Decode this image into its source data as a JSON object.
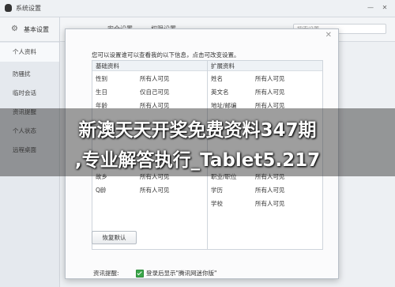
{
  "window": {
    "title": "系统设置",
    "minimize": "—",
    "close": "✕"
  },
  "sidebar": {
    "header": "基本设置",
    "items": [
      {
        "label": "个人资料"
      },
      {
        "label": "防骚扰"
      },
      {
        "label": "临时会话"
      },
      {
        "label": "资讯提醒"
      },
      {
        "label": "个人状态"
      },
      {
        "label": "远程桌面"
      }
    ]
  },
  "topbar": {
    "tab1": "安全设置",
    "tab2": "权限设置",
    "search_placeholder": "搜索设置"
  },
  "dialog": {
    "close": "✕",
    "intro": "您可以设置谁可以查看我的以下信息，点击可改变设置。",
    "basic": {
      "title": "基础资料",
      "rows": [
        {
          "k": "性别",
          "v": "所有人可见"
        },
        {
          "k": "生日",
          "v": "仅自己可见"
        },
        {
          "k": "年龄",
          "v": "所有人可见"
        },
        {
          "k": "故乡",
          "v": "所有人可见"
        },
        {
          "k": "Q龄",
          "v": "所有人可见"
        }
      ]
    },
    "extended": {
      "title": "扩展资料",
      "rows": [
        {
          "k": "姓名",
          "v": "所有人可见"
        },
        {
          "k": "英文名",
          "v": "所有人可见"
        },
        {
          "k": "地址/邮编",
          "v": "所有人可见"
        },
        {
          "k": "职业/职位",
          "v": "所有人可见"
        },
        {
          "k": "学历",
          "v": "所有人可见"
        },
        {
          "k": "学校",
          "v": "所有人可见"
        }
      ]
    },
    "restore_label": "恢复默认"
  },
  "footer": {
    "label": "资讯提醒:",
    "option": "登录后显示\"腾讯网迷你版\""
  },
  "overlay": {
    "line1": "新澳天天开奖免费资料347期",
    "line2": ",专业解答执行_Tablet5.217"
  }
}
